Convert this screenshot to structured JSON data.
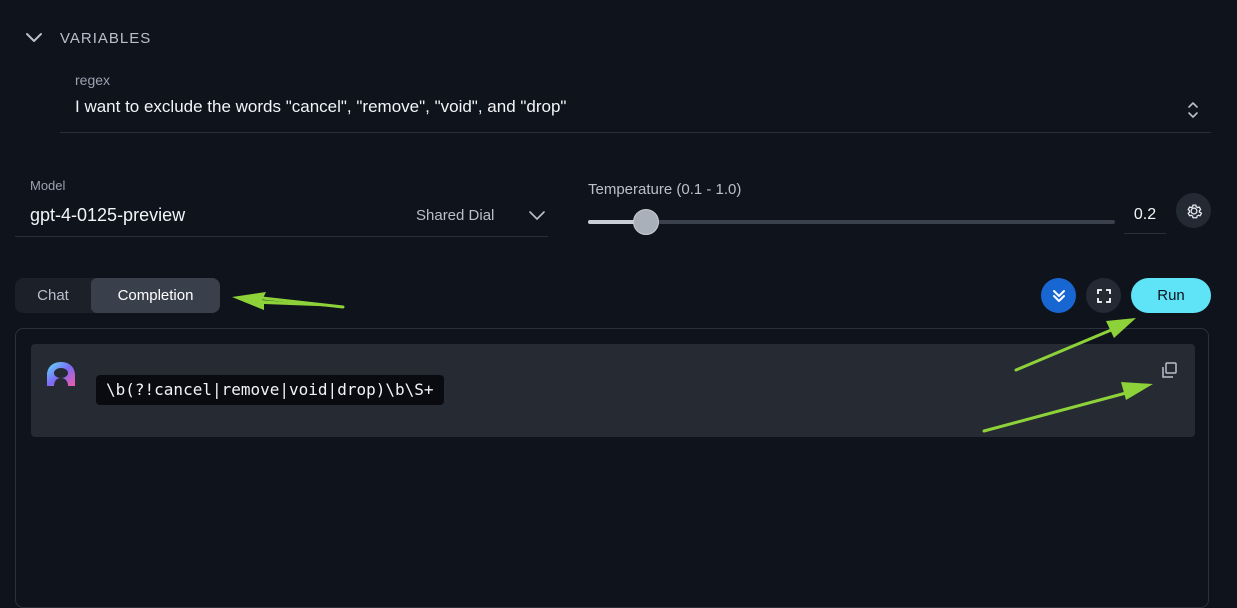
{
  "variables": {
    "section_title": "VARIABLES",
    "items": [
      {
        "label": "regex",
        "value": "I want to exclude the words \"cancel\", \"remove\", \"void\", and \"drop\""
      }
    ]
  },
  "model": {
    "label": "Model",
    "value": "gpt-4-0125-preview",
    "provider": "Shared Dial"
  },
  "temperature": {
    "label": "Temperature (0.1 - 1.0)",
    "value": "0.2",
    "level": 0.11
  },
  "tabs": [
    {
      "label": "Chat",
      "active": false
    },
    {
      "label": "Completion",
      "active": true
    }
  ],
  "toolbar": {
    "run_label": "Run"
  },
  "output": {
    "code": "\\b(?!cancel|remove|void|drop)\\b\\S+"
  },
  "colors": {
    "background": "#0f131b",
    "accent_run": "#5fe3f7",
    "accent_blue": "#1866d2",
    "annotation_arrow": "#8ed23a"
  },
  "icons": {
    "section_toggle": "chevron-down-icon",
    "variable_spinner": "spinner-updown-icon",
    "model_dropdown": "chevron-down-icon",
    "settings": "gear-icon",
    "scroll_bottom": "double-chevron-down-icon",
    "fullscreen": "fullscreen-icon",
    "avatar": "assistant-logo-icon",
    "copy": "copy-icon"
  }
}
